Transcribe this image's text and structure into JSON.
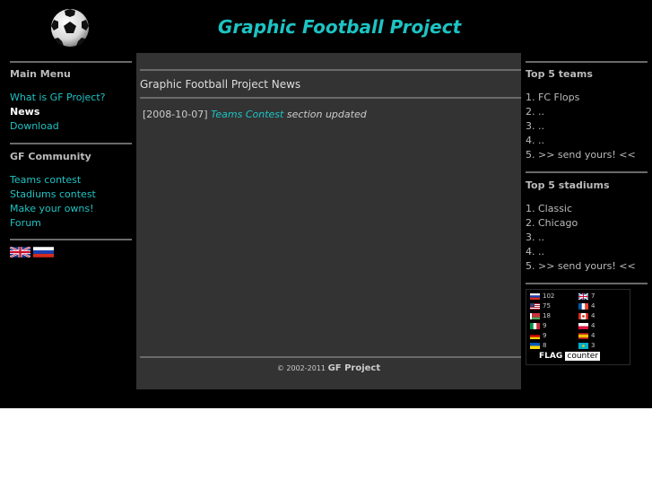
{
  "header": {
    "title": "Graphic Football Project"
  },
  "left": {
    "main_menu_heading": "Main Menu",
    "menu_items": [
      {
        "label": "What is GF Project?",
        "active": false
      },
      {
        "label": "News",
        "active": true
      },
      {
        "label": "Download",
        "active": false
      }
    ],
    "community_heading": "GF Community",
    "community_items": [
      {
        "label": "Teams contest"
      },
      {
        "label": "Stadiums contest"
      },
      {
        "label": "Make your owns!"
      },
      {
        "label": "Forum"
      }
    ],
    "language_flags": [
      "uk-flag-icon",
      "russia-flag-icon"
    ]
  },
  "main": {
    "news_heading": "Graphic Football Project News",
    "news": [
      {
        "date": "[2008-10-07]",
        "link": "Teams Contest",
        "text": "section updated"
      }
    ],
    "copyright_prefix": "© 2002-2011",
    "copyright_name": "GF Project"
  },
  "right": {
    "teams_heading": "Top 5 teams",
    "teams": [
      "1. FC Flops",
      "2. ..",
      "3. ..",
      "4. ..",
      "5. >> send yours! <<"
    ],
    "stadiums_heading": "Top 5 stadiums",
    "stadiums": [
      "1. Classic",
      "2. Chicago",
      "3. ..",
      "4. ..",
      "5. >> send yours! <<"
    ],
    "flag_counter": {
      "left_column": [
        {
          "flag": "russia",
          "count": "102"
        },
        {
          "flag": "usa",
          "count": "75"
        },
        {
          "flag": "belarus",
          "count": "18"
        },
        {
          "flag": "italy",
          "count": "9"
        },
        {
          "flag": "germany",
          "count": "9"
        },
        {
          "flag": "ukraine",
          "count": "8"
        }
      ],
      "right_column": [
        {
          "flag": "uk",
          "count": "7"
        },
        {
          "flag": "france",
          "count": "4"
        },
        {
          "flag": "canada",
          "count": "4"
        },
        {
          "flag": "poland",
          "count": "4"
        },
        {
          "flag": "spain",
          "count": "4"
        },
        {
          "flag": "kazakhstan",
          "count": "3"
        }
      ],
      "brand": "FLAG",
      "brand_box": "counter"
    }
  },
  "colors": {
    "accent": "#1ec3c3",
    "background": "#000000",
    "panel": "#333333",
    "rule": "#6a6a6a"
  }
}
